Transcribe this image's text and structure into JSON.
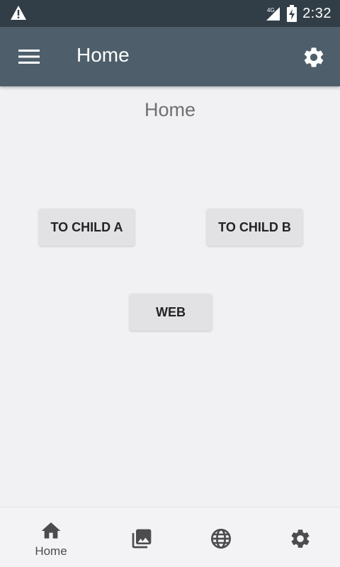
{
  "status_bar": {
    "network": "4G",
    "time": "2:32",
    "icons": [
      "warning-icon",
      "signal-icon",
      "battery-icon"
    ]
  },
  "app_bar": {
    "title": "Home",
    "menu_icon": "hamburger-menu-icon",
    "settings_icon": "gear-icon"
  },
  "main": {
    "heading": "Home",
    "buttons": {
      "child_a": "TO CHILD A",
      "child_b": "TO CHILD B",
      "web": "WEB"
    }
  },
  "bottom_nav": {
    "items": [
      {
        "icon": "home-icon",
        "label": "Home",
        "active": true
      },
      {
        "icon": "photo-library-icon",
        "label": "",
        "active": false
      },
      {
        "icon": "globe-icon",
        "label": "",
        "active": false
      },
      {
        "icon": "gear-icon",
        "label": "",
        "active": false
      }
    ]
  },
  "colors": {
    "status_bar": "#323e47",
    "app_bar": "#4e5f6b",
    "background": "#f1f1f3",
    "button": "#e2e1e4",
    "nav_icon": "#4c4c50"
  }
}
